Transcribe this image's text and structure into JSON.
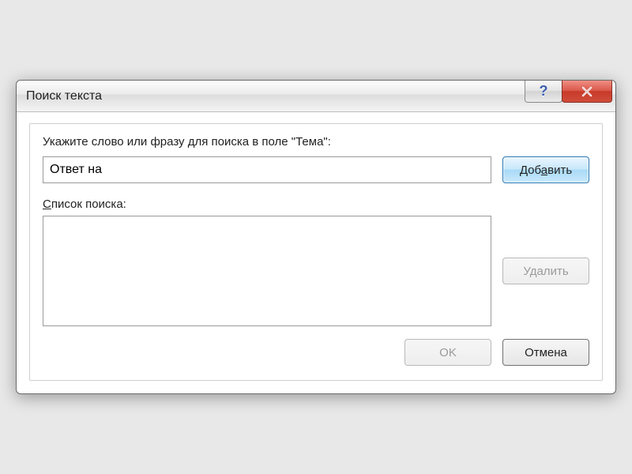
{
  "titlebar": {
    "title": "Поиск текста"
  },
  "prompt_label": "Укажите слово или фразу для поиска в поле \"Тема\":",
  "search_input_value": "Ответ на",
  "add_button": {
    "prefix": "Доб",
    "access": "а",
    "suffix": "вить"
  },
  "list_label_prefix": "С",
  "list_label_suffix": "писок поиска:",
  "delete_button": "Удалить",
  "ok_button": "OK",
  "cancel_button": "Отмена",
  "search_list_items": []
}
